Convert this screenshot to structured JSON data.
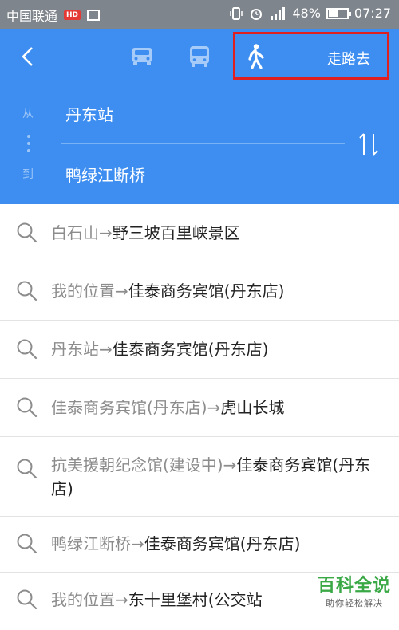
{
  "status_bar": {
    "carrier": "中国联通",
    "carrier_badge": "HD",
    "battery": "48%",
    "battery_level": 0.48,
    "time": "07:27"
  },
  "header": {
    "go_label": "走路去",
    "from_label": "从",
    "to_label": "到",
    "from_value": "丹东站",
    "to_value": "鸭绿江断桥"
  },
  "history": [
    {
      "from": "白石山",
      "arrow": "→",
      "to": "野三坡百里峡景区"
    },
    {
      "from": "我的位置",
      "arrow": "→",
      "to": "佳泰商务宾馆(丹东店)"
    },
    {
      "from": "丹东站",
      "arrow": "→",
      "to": "佳泰商务宾馆(丹东店)"
    },
    {
      "from": "佳泰商务宾馆(丹东店)",
      "arrow": "→",
      "to": "虎山长城"
    },
    {
      "from": "抗美援朝纪念馆(建设中)",
      "arrow": "→",
      "to": "佳泰商务宾馆(丹东店)"
    },
    {
      "from": "鸭绿江断桥",
      "arrow": "→",
      "to": "佳泰商务宾馆(丹东店)"
    },
    {
      "from": "我的位置",
      "arrow": "→",
      "to": "东十里堡村(公交站"
    }
  ],
  "watermark": {
    "title": "百科全说",
    "subtitle": "助你轻松解决"
  },
  "colors": {
    "header": "#3d8ef0",
    "highlight_box": "#e02020",
    "status_bar": "#7f858c"
  }
}
